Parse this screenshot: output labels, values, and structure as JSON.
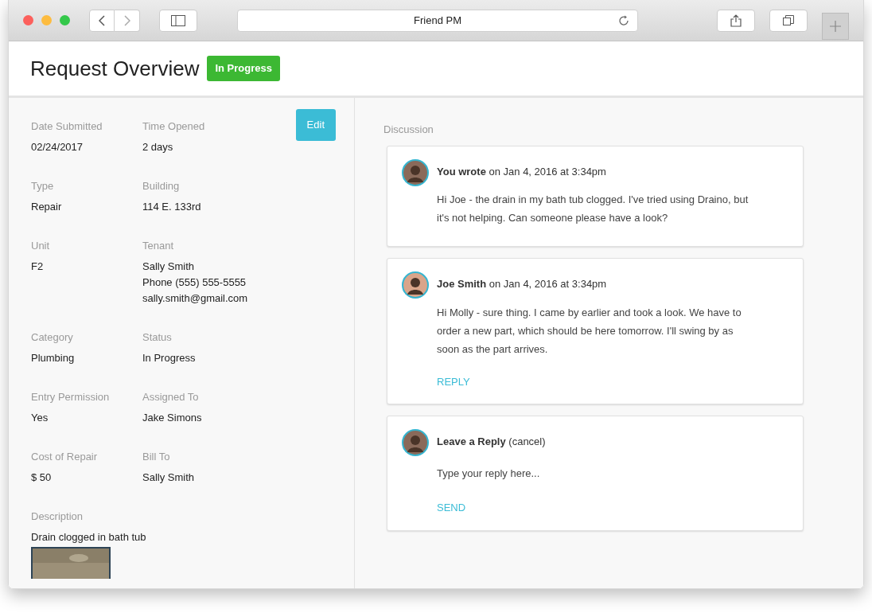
{
  "browser": {
    "address": "Friend PM"
  },
  "header": {
    "title": "Request Overview",
    "badge": "In Progress"
  },
  "details": {
    "edit_button": "Edit",
    "rows": [
      [
        {
          "label": "Date Submitted",
          "lines": [
            "02/24/2017"
          ]
        },
        {
          "label": "Time Opened",
          "lines": [
            "2 days"
          ]
        }
      ],
      [
        {
          "label": "Type",
          "lines": [
            "Repair"
          ]
        },
        {
          "label": "Building",
          "lines": [
            "114 E. 133rd"
          ]
        }
      ],
      [
        {
          "label": "Unit",
          "lines": [
            "F2"
          ]
        },
        {
          "label": "Tenant",
          "lines": [
            "Sally Smith",
            "Phone (555) 555-5555",
            "sally.smith@gmail.com"
          ]
        }
      ],
      [
        {
          "label": "Category",
          "lines": [
            "Plumbing"
          ]
        },
        {
          "label": "Status",
          "lines": [
            "In Progress"
          ]
        }
      ],
      [
        {
          "label": "Entry Permission",
          "lines": [
            "Yes"
          ]
        },
        {
          "label": "Assigned To",
          "lines": [
            "Jake Simons"
          ]
        }
      ],
      [
        {
          "label": "Cost of Repair",
          "lines": [
            "$ 50"
          ]
        },
        {
          "label": "Bill To",
          "lines": [
            "Sally Smith"
          ]
        }
      ],
      [
        {
          "label": "Description",
          "lines": [
            "Drain clogged in bath tub"
          ]
        }
      ]
    ],
    "attachment": {
      "kind": "picture"
    }
  },
  "discussion": {
    "title": "Discussion",
    "comments": [
      {
        "kind": "message",
        "heading": "**You wrote** on Jan 4, 2016 at 3:34pm",
        "color": "#8a6a5a",
        "body": "Hi Joe - the drain in my bath tub clogged. I've tried using Draino, but it's not helping. Can someone please have a look?"
      },
      {
        "kind": "message",
        "heading": "**Joe Smith** on Jan 4, 2016 at 3:34pm",
        "color": "#d9a58a",
        "body": "Hi Molly - sure thing. I came by earlier and took a look. We have to order a new part, which should be here tomorrow. I'll swing by as soon as the part arrives.",
        "action": "REPLY"
      },
      {
        "kind": "compose",
        "heading": "**Leave a Reply** (cancel)",
        "color": "#8a6a5a",
        "placeholder": "Type your reply here...",
        "action": "SEND"
      }
    ]
  }
}
